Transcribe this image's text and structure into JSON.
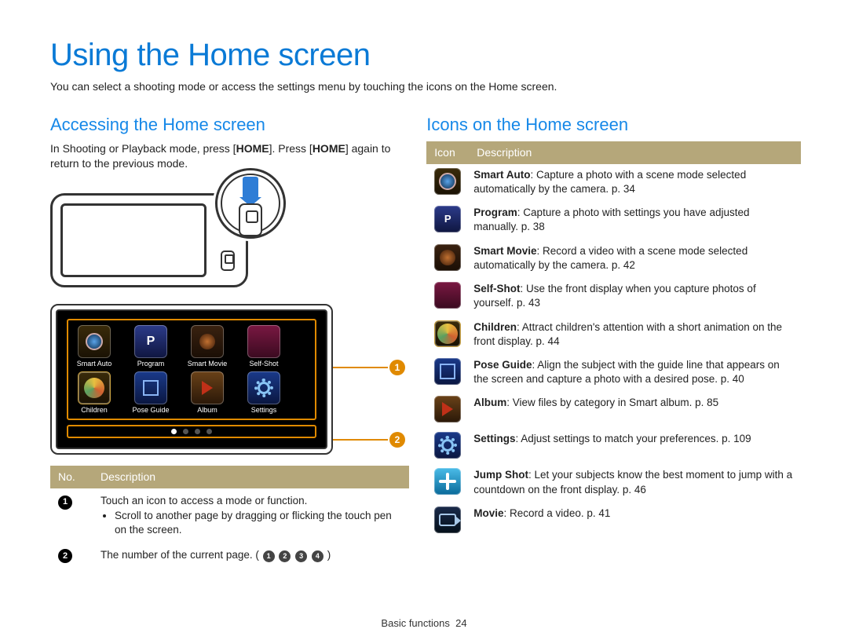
{
  "page": {
    "title": "Using the Home screen",
    "intro": "You can select a shooting mode or access the settings menu by touching the icons on the Home screen.",
    "footer_label": "Basic functions",
    "footer_page": "24"
  },
  "left": {
    "section_title": "Accessing the Home screen",
    "body_prefix": "In Shooting or Playback mode, press [",
    "body_home1": "HOME",
    "body_mid": "]. Press [",
    "body_home2": "HOME",
    "body_suffix": "] again to return to the previous mode.",
    "home_icons": [
      {
        "key": "smart_auto",
        "label": "Smart Auto"
      },
      {
        "key": "program",
        "label": "Program"
      },
      {
        "key": "smart_movie",
        "label": "Smart Movie"
      },
      {
        "key": "self_shot",
        "label": "Self-Shot"
      },
      {
        "key": "children",
        "label": "Children"
      },
      {
        "key": "pose_guide",
        "label": "Pose Guide"
      },
      {
        "key": "album",
        "label": "Album"
      },
      {
        "key": "settings",
        "label": "Settings"
      }
    ],
    "callout_1": "1",
    "callout_2": "2",
    "table_headers": {
      "no": "No.",
      "desc": "Description"
    },
    "row1": {
      "num": "1",
      "line1": "Touch an icon to access a mode or function.",
      "bullet": "Scroll to another page by dragging or flicking the touch pen on the screen."
    },
    "row2": {
      "num": "2",
      "line_prefix": "The number of the current page. (",
      "dots": [
        "1",
        "2",
        "3",
        "4"
      ],
      "line_suffix": ")"
    }
  },
  "right": {
    "section_title": "Icons on the Home screen",
    "table_headers": {
      "icon": "Icon",
      "desc": "Description"
    },
    "rows": [
      {
        "icon": "smart_auto",
        "name": "Smart Auto",
        "text": ": Capture a photo with a scene mode selected automatically by the camera. p. 34"
      },
      {
        "icon": "program",
        "name": "Program",
        "text": ": Capture a photo with settings you have adjusted manually. p. 38"
      },
      {
        "icon": "smart_movie",
        "name": "Smart Movie",
        "text": ": Record a video with a scene mode selected automatically by the camera. p. 42"
      },
      {
        "icon": "self_shot",
        "name": "Self-Shot",
        "text": ": Use the front display when you capture photos of yourself. p. 43"
      },
      {
        "icon": "children",
        "name": "Children",
        "text": ": Attract children's attention with a short animation on the front display. p. 44"
      },
      {
        "icon": "pose_guide",
        "name": "Pose Guide",
        "text": ": Align the subject with the guide line that appears on the screen and capture a photo with a desired pose. p. 40"
      },
      {
        "icon": "album",
        "name": "Album",
        "text": ": View files by category in Smart album. p. 85"
      },
      {
        "icon": "settings",
        "name": "Settings",
        "text": ": Adjust settings to match your preferences. p. 109"
      },
      {
        "icon": "jump_shot",
        "name": "Jump Shot",
        "text": ": Let your subjects know the best moment to jump with a countdown on the front display. p. 46"
      },
      {
        "icon": "movie",
        "name": "Movie",
        "text": ": Record a video. p. 41"
      }
    ]
  }
}
